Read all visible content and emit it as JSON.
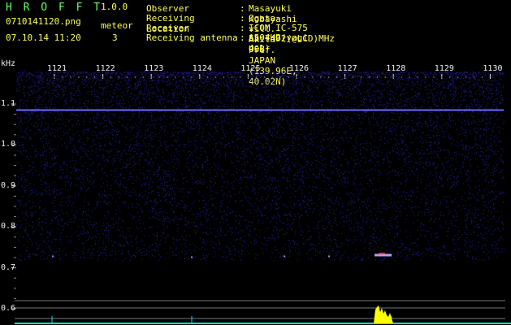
{
  "header": {
    "app_title": "H R O F F T",
    "app_version": "1.0.0",
    "file_name": "0710141120.png",
    "timestamp": "07.10.14 11:20",
    "meteor_label": "meteor",
    "meteor_count": "3"
  },
  "info": [
    {
      "label": "Observer",
      "value": "Masayuki Kobayashi"
    },
    {
      "label": "Receiving Location",
      "value": "Ogata-vill. Akita-Pref. JAPAN (139.96E, 40.02N)"
    },
    {
      "label": "Receiver",
      "value": "ICOM IC-575 53.7492(@LCD)MHz USB"
    },
    {
      "label": "Receiving antenna",
      "value": "A504HB(yagi 4el)"
    }
  ],
  "info_colon": ":",
  "spectrogram": {
    "y_unit": "kHz",
    "time_ticks": [
      "1121",
      "1122",
      "1123",
      "1124",
      "1125",
      "1126",
      "1127",
      "1128",
      "1129",
      "1130"
    ],
    "freq_ticks": [
      "1.1",
      "1.0",
      "0.9",
      "0.8",
      "0.7",
      "0.6"
    ],
    "carrier_line_khz": 1.085,
    "colors": {
      "noise": "#2a2ad0",
      "carrier": "#6a6aff",
      "text_yellow": "#ffff55",
      "text_green": "#66ff66",
      "signal_peak": "#ffff00",
      "baseline": "#00e0e0"
    }
  }
}
